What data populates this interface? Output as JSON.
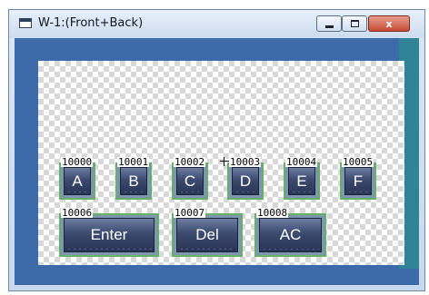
{
  "window": {
    "title": "W-1:(Front+Back)",
    "controls": {
      "minimize": "minimize",
      "maximize": "maximize",
      "close": "x"
    }
  },
  "keys": [
    {
      "id": "10000",
      "label": "A"
    },
    {
      "id": "10001",
      "label": "B"
    },
    {
      "id": "10002",
      "label": "C"
    },
    {
      "id": "10003",
      "label": "D"
    },
    {
      "id": "10004",
      "label": "E"
    },
    {
      "id": "10005",
      "label": "F"
    },
    {
      "id": "10006",
      "label": "Enter"
    },
    {
      "id": "10007",
      "label": "Del"
    },
    {
      "id": "10008",
      "label": "AC"
    }
  ],
  "colors": {
    "key_outline": "#64b064",
    "client_background": "#3d6aa8",
    "client_right_band": "#2f8596",
    "close_button": "#c74a35"
  }
}
